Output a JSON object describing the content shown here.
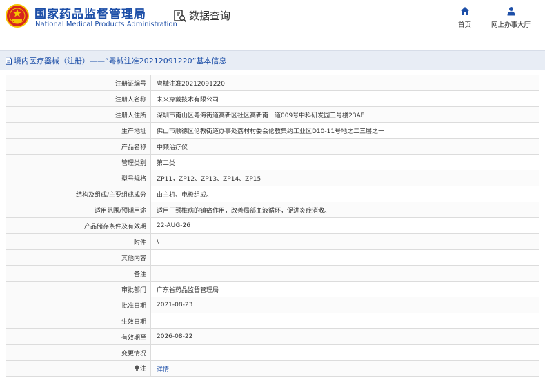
{
  "header": {
    "site_name": "国家药品监督管理局",
    "site_name_en": "National Medical Products Administration",
    "query_label": "数据查询",
    "nav": [
      {
        "label": "首页",
        "icon": "home-icon"
      },
      {
        "label": "网上办事大厅",
        "icon": "user-icon"
      }
    ]
  },
  "page": {
    "title": "境内医疗器械（注册）——“粤械注准20212091220”基本信息"
  },
  "details": {
    "rows": [
      {
        "label": "注册证编号",
        "value": "粤械注准20212091220"
      },
      {
        "label": "注册人名称",
        "value": "未来穿戴技术有限公司"
      },
      {
        "label": "注册人住所",
        "value": "深圳市南山区粤海街道高新区社区高新南一道009号中科研发园三号楼23AF"
      },
      {
        "label": "生产地址",
        "value": "佛山市顺德区伦教街道办事处荔村村委会伦教集约工业区D10-11号地之二三层之一"
      },
      {
        "label": "产品名称",
        "value": "中频治疗仪"
      },
      {
        "label": "管理类别",
        "value": "第二类"
      },
      {
        "label": "型号规格",
        "value": "ZP11，ZP12、ZP13、ZP14、ZP15"
      },
      {
        "label": "结构及组成/主要组成成分",
        "value": "由主机、电极组成。"
      },
      {
        "label": "适用范围/预期用途",
        "value": "适用于颈椎病的镇痛作用，改善局部血液循环，促进炎症消散。"
      },
      {
        "label": "产品储存条件及有效期",
        "value": "22-AUG-26"
      },
      {
        "label": "附件",
        "value": "\\"
      },
      {
        "label": "其他内容",
        "value": ""
      },
      {
        "label": "备注",
        "value": ""
      },
      {
        "label": "审批部门",
        "value": "广东省药品监督管理局"
      },
      {
        "label": "批准日期",
        "value": "2021-08-23"
      },
      {
        "label": "生效日期",
        "value": ""
      },
      {
        "label": "有效期至",
        "value": "2026-08-22"
      },
      {
        "label": "变更情况",
        "value": ""
      }
    ],
    "note": {
      "label": "注",
      "link_text": "详情",
      "label_icon": "lightbulb-icon"
    }
  },
  "colors": {
    "brand_blue": "#1d4fa8",
    "emblem_red": "#d7261e",
    "emblem_gold": "#f5c400",
    "titlebar_bg": "#e8edf5"
  }
}
